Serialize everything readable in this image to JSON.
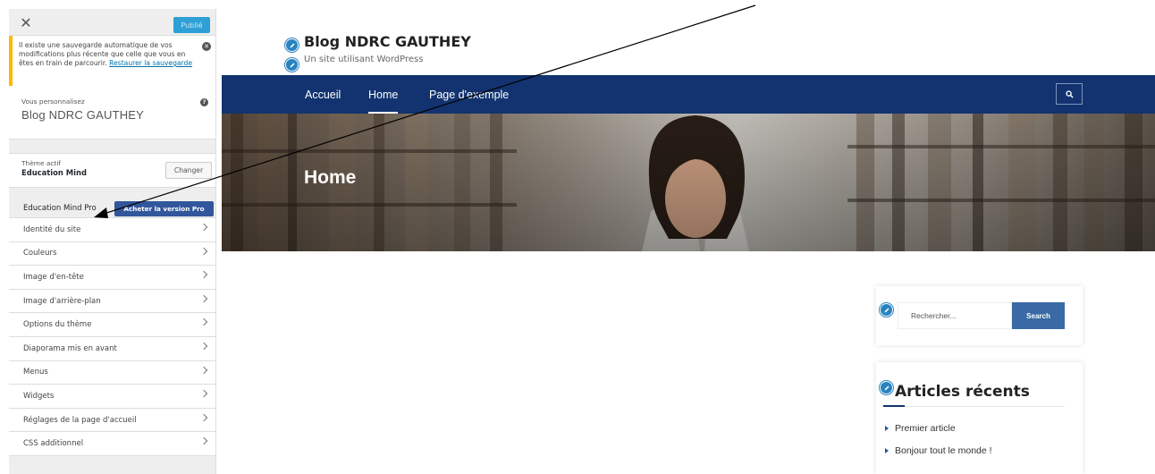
{
  "sidebar": {
    "close_symbol": "✕",
    "publish_label": "Publié",
    "notice": {
      "text": "Il existe une sauvegarde automatique de vos modifications plus récente que celle que vous en êtes en train de parcourir.",
      "link_label": "Restaurer la sauvegarde",
      "dismiss_symbol": "✕"
    },
    "customizing_label": "Vous personnalisez",
    "site_name": "Blog NDRC GAUTHEY",
    "help_symbol": "?",
    "active_theme_label": "Thème actif",
    "active_theme_name": "Education Mind",
    "change_button": "Changer",
    "pro_label": "Education Mind Pro",
    "pro_button": "Acheter la version Pro",
    "items": [
      {
        "label": "Identité du site"
      },
      {
        "label": "Couleurs"
      },
      {
        "label": "Image d'en-tête"
      },
      {
        "label": "Image d'arrière-plan"
      },
      {
        "label": "Options du thème"
      },
      {
        "label": "Diaporama mis en avant"
      },
      {
        "label": "Menus"
      },
      {
        "label": "Widgets"
      },
      {
        "label": "Réglages de la page d'accueil"
      },
      {
        "label": "CSS additionnel"
      }
    ]
  },
  "preview": {
    "site_title": "Blog NDRC GAUTHEY",
    "tagline": "Un site utilisant WordPress",
    "nav": [
      {
        "label": "Accueil"
      },
      {
        "label": "Home"
      },
      {
        "label": "Page d'exemple"
      }
    ],
    "active_nav": "Home",
    "hero_title": "Home",
    "search_placeholder": "Rechercher...",
    "search_button": "Search",
    "recent_title": "Articles récents",
    "recent_posts": [
      {
        "label": "Premier article"
      },
      {
        "label": "Bonjour tout le monde !"
      }
    ]
  },
  "colors": {
    "nav_bg": "#12336f",
    "pro_button": "#32569b",
    "publish_button": "#2ea0d5",
    "notice_border": "#ffb900",
    "edit_pencil": "#2982c0"
  },
  "icons": [
    "close-icon",
    "dismiss-icon",
    "help-icon",
    "chevron-right-icon",
    "edit-pencil-icon",
    "search-icon",
    "triangle-bullet-icon"
  ]
}
